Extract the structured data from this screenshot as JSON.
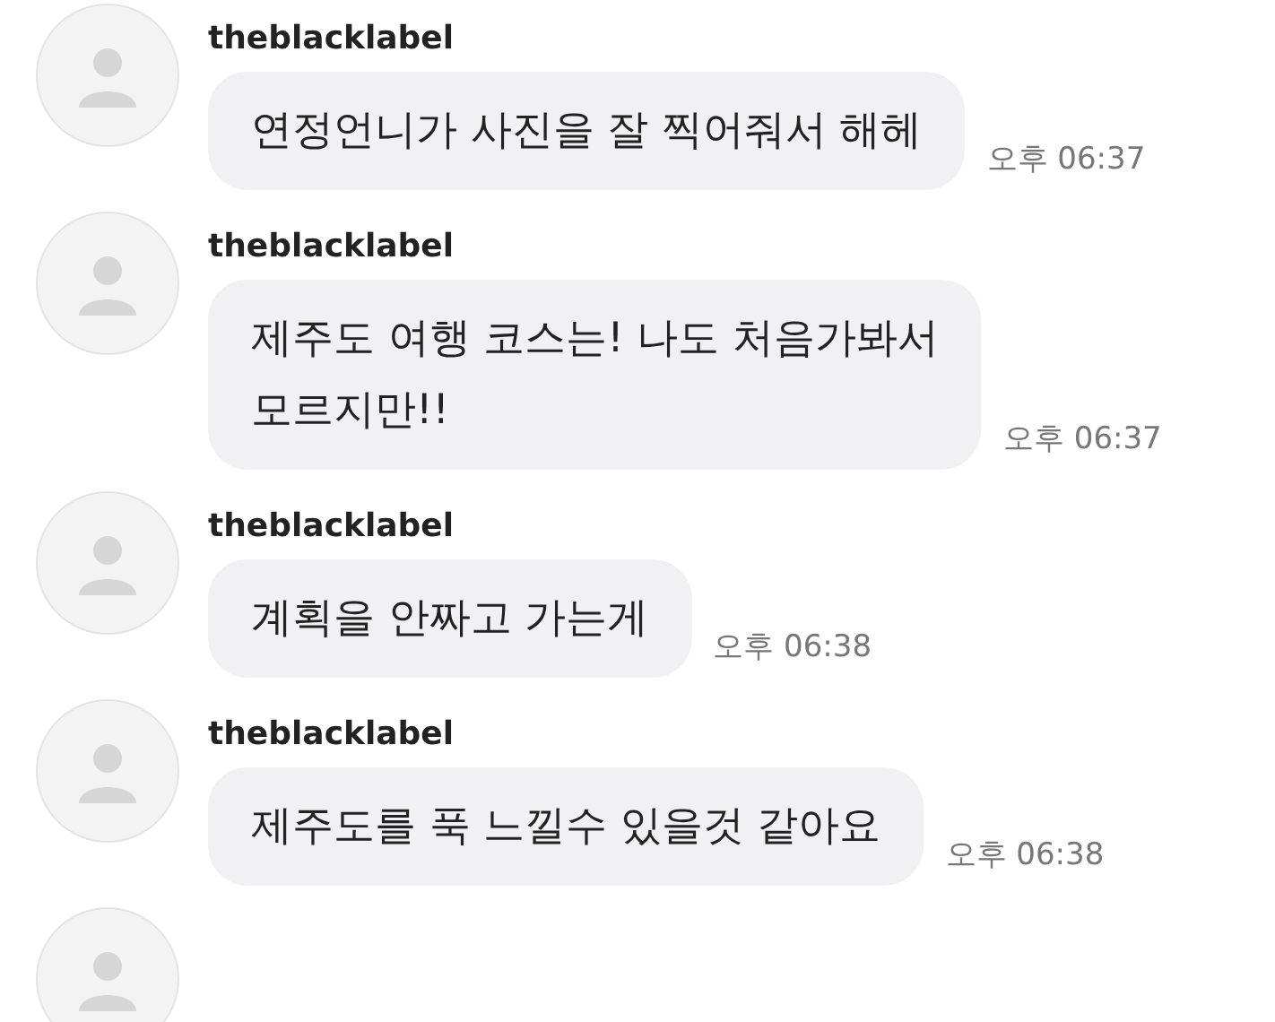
{
  "messages": [
    {
      "sender": "theblacklabel",
      "lines": [
        "연정언니가 사진을 잘 찍어줘서 해헤"
      ],
      "time": "오후 06:37"
    },
    {
      "sender": "theblacklabel",
      "lines": [
        "제주도 여행 코스는! 나도 처음가봐서",
        "모르지만!!"
      ],
      "time": "오후 06:37"
    },
    {
      "sender": "theblacklabel",
      "lines": [
        "계획을 안짜고 가는게"
      ],
      "time": "오후 06:38"
    },
    {
      "sender": "theblacklabel",
      "lines": [
        "제주도를 푹 느낄수 있을것 같아요"
      ],
      "time": "오후 06:38"
    }
  ]
}
